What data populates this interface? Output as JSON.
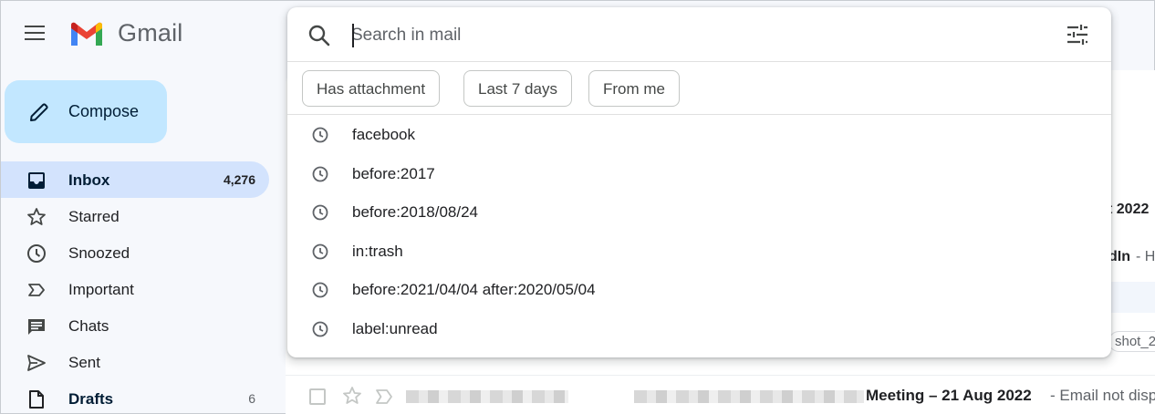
{
  "header": {
    "brand": "Gmail"
  },
  "compose": {
    "label": "Compose"
  },
  "nav": [
    {
      "label": "Inbox",
      "count": "4,276",
      "icon": "inbox-icon"
    },
    {
      "label": "Starred",
      "count": "",
      "icon": "star-icon"
    },
    {
      "label": "Snoozed",
      "count": "",
      "icon": "clock-icon"
    },
    {
      "label": "Important",
      "count": "",
      "icon": "important-icon"
    },
    {
      "label": "Chats",
      "count": "",
      "icon": "chat-icon"
    },
    {
      "label": "Sent",
      "count": "",
      "icon": "send-icon"
    },
    {
      "label": "Drafts",
      "count": "6",
      "icon": "draft-icon"
    }
  ],
  "search": {
    "placeholder": "Search in mail",
    "chips": [
      "Has attachment",
      "Last 7 days",
      "From me"
    ],
    "recent": [
      "facebook",
      "before:2017",
      "before:2018/08/24",
      "in:trash",
      "before:2021/04/04 after:2020/05/04",
      "label:unread"
    ]
  },
  "mail_bg": {
    "fragment_1": "t 2022",
    "fragment_2": "dIn",
    "fragment_2b": "- H",
    "fragment_3": "shot_2",
    "row": {
      "subject": "Meeting – 21 Aug 2022",
      "snippet": "- Email not disp"
    }
  },
  "colors": {
    "background": "#f6f8fc",
    "compose": "#c2e7ff",
    "active_nav": "#d3e3fd"
  }
}
